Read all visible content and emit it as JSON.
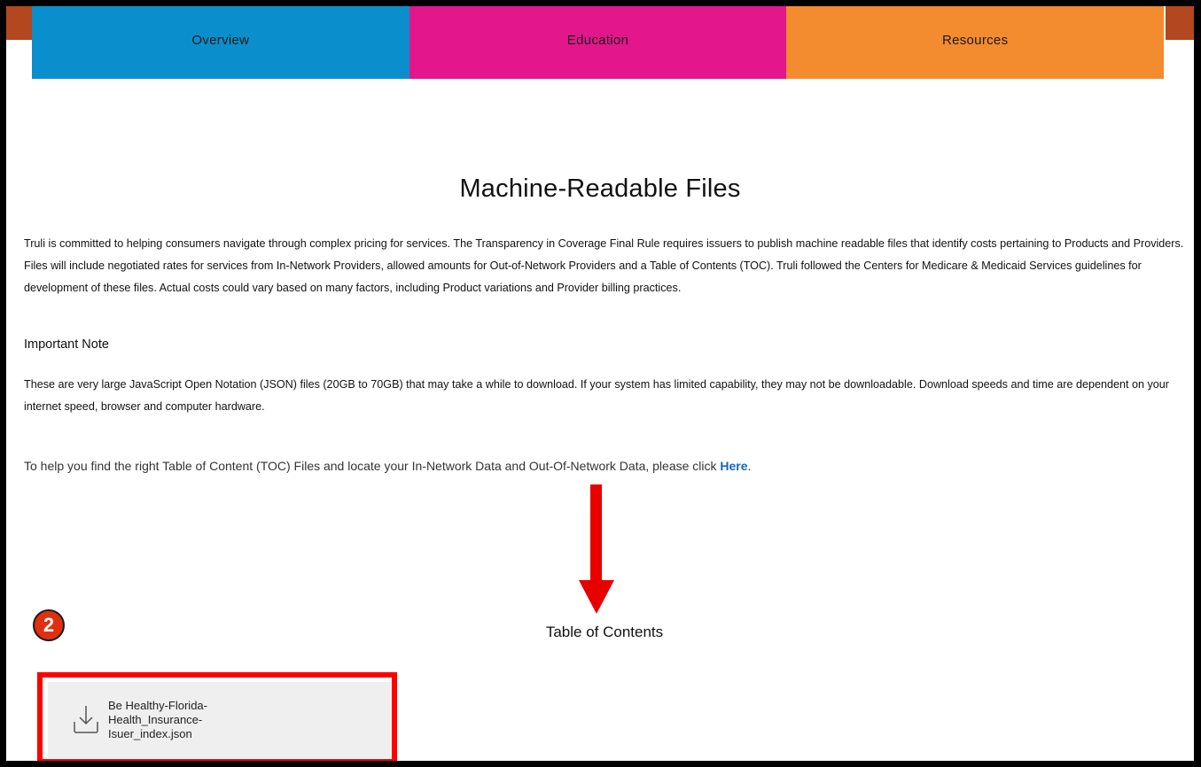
{
  "nav": {
    "tabs": [
      {
        "label": "Overview",
        "color": "#0a8fcc"
      },
      {
        "label": "Education",
        "color": "#e3168b"
      },
      {
        "label": "Resources",
        "color": "#f38b2f"
      }
    ]
  },
  "main": {
    "title": "Machine-Readable Files",
    "intro": "Truli is committed to helping consumers navigate through complex pricing for services. The Transparency in Coverage Final Rule requires issuers to publish machine readable files that identify costs pertaining to Products and Providers. Files will include negotiated rates for services from In-Network Providers, allowed amounts for Out-of-Network Providers and a Table of Contents (TOC). Truli followed the Centers for Medicare & Medicaid Services guidelines for development of these files. Actual costs could vary based on many factors, including Product variations and Provider billing practices.",
    "note_heading": "Important Note",
    "note_text": "These are very large JavaScript Open Notation (JSON) files (20GB to 70GB) that may take a while to download. If your system has limited capability, they may not be downloadable. Download speeds and time are dependent on your internet speed, browser and computer hardware.",
    "help_text": "To help you find the right Table of Content (TOC) Files and locate your In-Network Data and Out-Of-Network Data, please click ",
    "help_link": "Here",
    "help_suffix": "."
  },
  "annotation": {
    "step_number": "2",
    "highlight_color": "#ff0000"
  },
  "toc": {
    "heading": "Table of Contents",
    "files": [
      {
        "name": "Be Healthy-Florida-Health_Insurance-Isuer_index.json",
        "icon": "download-icon"
      }
    ]
  }
}
